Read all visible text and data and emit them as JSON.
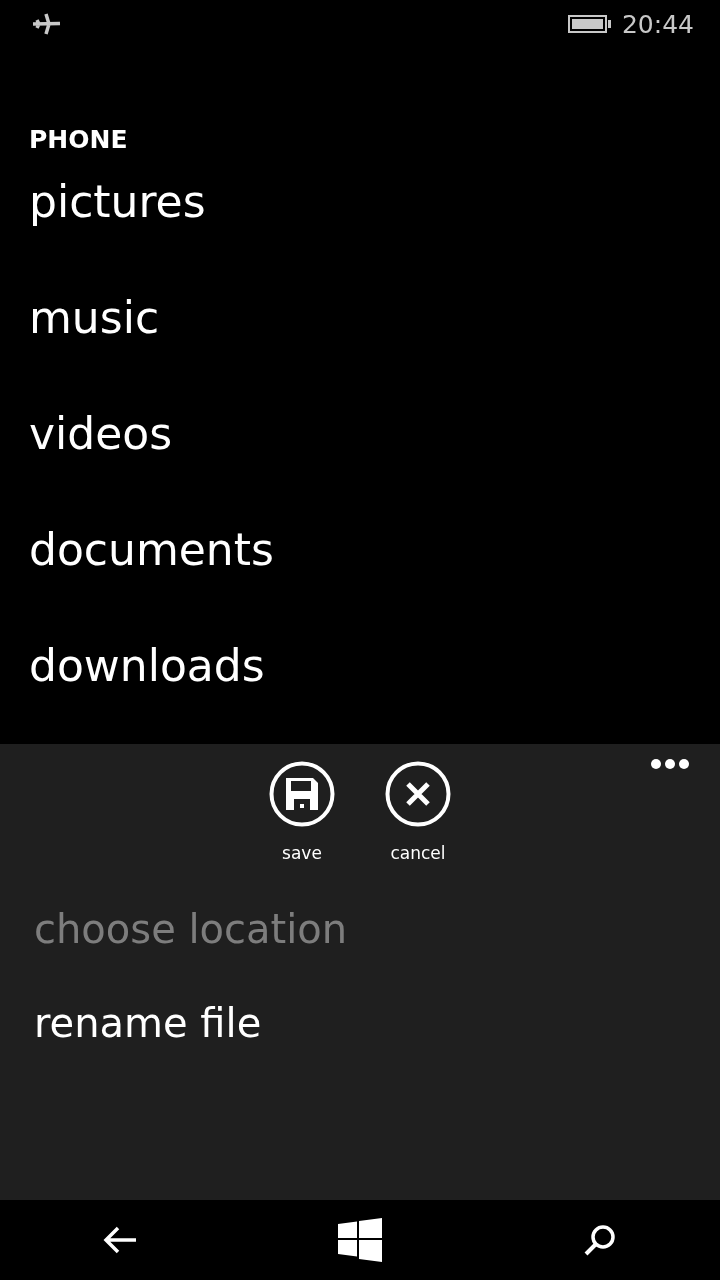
{
  "status_bar": {
    "time": "20:44"
  },
  "section_title": "PHONE",
  "folders": [
    "pictures",
    "music",
    "videos",
    "documents",
    "downloads"
  ],
  "app_bar": {
    "buttons": [
      {
        "kind": "save",
        "label": "save"
      },
      {
        "kind": "cancel",
        "label": "cancel"
      }
    ],
    "menu_items": [
      {
        "label": "choose location",
        "disabled": true
      },
      {
        "label": "rename file",
        "disabled": false
      }
    ]
  }
}
